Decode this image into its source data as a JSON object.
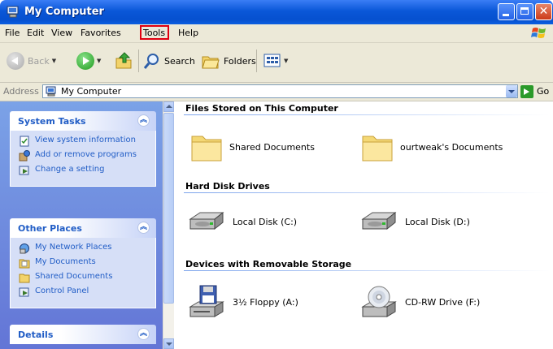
{
  "window": {
    "title": "My Computer"
  },
  "menu": [
    "File",
    "Edit",
    "View",
    "Favorites",
    "Tools",
    "Help"
  ],
  "toolbar": {
    "back": "Back",
    "search": "Search",
    "folders": "Folders"
  },
  "address": {
    "label": "Address",
    "value": "My Computer",
    "go": "Go"
  },
  "sidebar": {
    "system_tasks": {
      "title": "System Tasks",
      "items": [
        "View system information",
        "Add or remove programs",
        "Change a setting"
      ]
    },
    "other_places": {
      "title": "Other Places",
      "items": [
        "My Network Places",
        "My Documents",
        "Shared Documents",
        "Control Panel"
      ]
    },
    "details": {
      "title": "Details"
    }
  },
  "groups": [
    {
      "title": "Files Stored on This Computer",
      "items": [
        "Shared Documents",
        "ourtweak's Documents"
      ]
    },
    {
      "title": "Hard Disk Drives",
      "items": [
        "Local Disk (C:)",
        "Local Disk (D:)"
      ]
    },
    {
      "title": "Devices with Removable Storage",
      "items": [
        "3½ Floppy (A:)",
        "CD-RW Drive (F:)"
      ]
    }
  ],
  "icons": [
    "computer-icon",
    "windows-logo-icon",
    "back-icon",
    "forward-icon",
    "up-folder-icon",
    "search-icon",
    "folders-icon",
    "views-icon",
    "go-icon",
    "folder-icon",
    "hard-disk-icon",
    "floppy-drive-icon",
    "cd-drive-icon"
  ],
  "colors": {
    "titlebar": "#0a57d8",
    "task_text": "#215dc6",
    "sidebar_bg": "#7ba2e7",
    "highlight_box": "#e00010"
  }
}
